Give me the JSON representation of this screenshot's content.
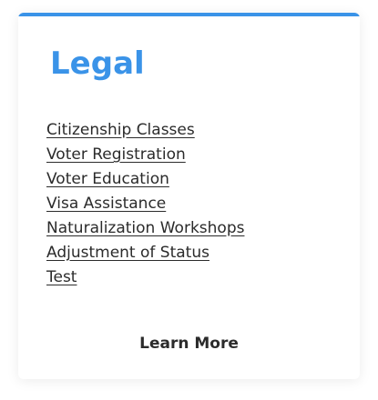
{
  "card": {
    "title": "Legal",
    "accent_color": "#3a93e8",
    "links": [
      "Citizenship Classes",
      "Voter Registration",
      "Voter Education",
      "Visa Assistance",
      "Naturalization Workshops",
      "Adjustment of Status",
      "Test"
    ],
    "cta_label": "Learn More"
  }
}
